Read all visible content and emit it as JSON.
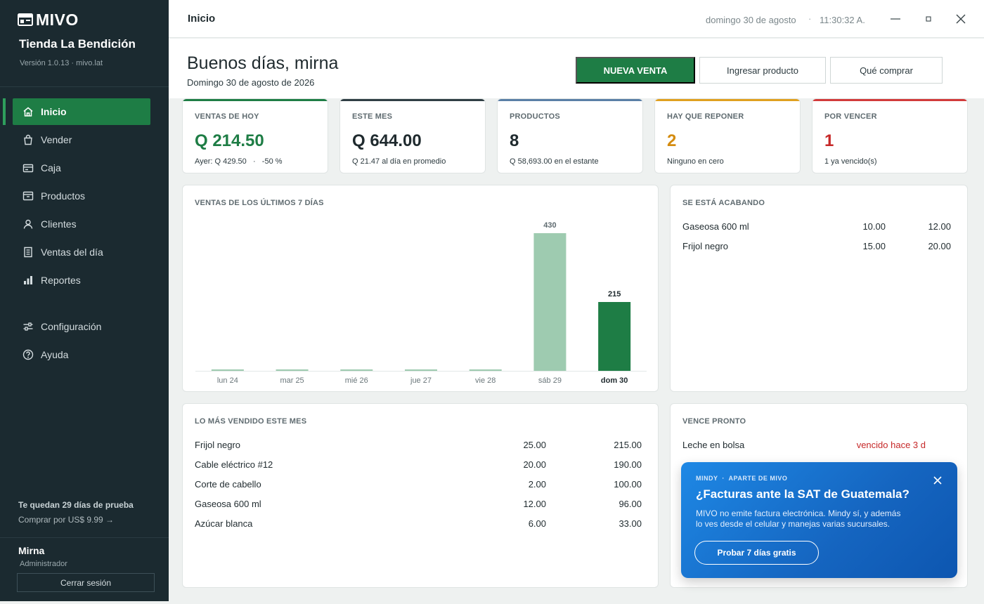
{
  "sidebar": {
    "logo_text": "MIVO",
    "store_name": "Tienda La Bendición",
    "version": "Versión 1.0.13 · mivo.lat",
    "items": [
      {
        "label": "Inicio",
        "icon": "home-icon"
      },
      {
        "label": "Vender",
        "icon": "bag-icon"
      },
      {
        "label": "Caja",
        "icon": "cash-register-icon"
      },
      {
        "label": "Productos",
        "icon": "box-icon"
      },
      {
        "label": "Clientes",
        "icon": "user-icon"
      },
      {
        "label": "Ventas del día",
        "icon": "receipt-icon"
      },
      {
        "label": "Reportes",
        "icon": "bar-chart-icon"
      },
      {
        "label": "Configuración",
        "icon": "sliders-icon"
      },
      {
        "label": "Ayuda",
        "icon": "help-icon"
      }
    ],
    "trial_title": "Te quedan 29 días de prueba",
    "trial_link": "Comprar por US$ 9.99 →",
    "user_name": "Mirna",
    "user_role": "Administrador",
    "logout_label": "Cerrar sesión"
  },
  "topbar": {
    "title": "Inicio",
    "date": "domingo 30 de agosto",
    "separator": "·",
    "time": "11:30:32 A."
  },
  "header": {
    "greeting": "Buenos días, mirna",
    "date": "Domingo 30 de agosto de 2026",
    "new_sale_label": "NUEVA VENTA",
    "add_product_label": "Ingresar producto",
    "what_to_buy_label": "Qué comprar"
  },
  "stats": [
    {
      "label": "VENTAS DE HOY",
      "value": "Q 214.50",
      "sub": "Ayer: Q 429.50   ·   -50 %",
      "accent": "#1e7d45",
      "value_color": "#1e7d45"
    },
    {
      "label": "ESTE MES",
      "value": "Q 644.00",
      "sub": "Q 21.47 al día en promedio",
      "accent": "#2f3e44",
      "value_color": "#1f2a2e"
    },
    {
      "label": "PRODUCTOS",
      "value": "8",
      "sub": "Q 58,693.00 en el estante",
      "accent": "#5a7fa6",
      "value_color": "#1f2a2e"
    },
    {
      "label": "HAY QUE REPONER",
      "value": "2",
      "sub": "Ninguno en cero",
      "accent": "#e0a020",
      "value_color": "#d48c10"
    },
    {
      "label": "POR VENCER",
      "value": "1",
      "sub": "1 ya vencido(s)",
      "accent": "#d23a3a",
      "value_color": "#c62828"
    }
  ],
  "chart_panel": {
    "title": "VENTAS DE LOS ÚLTIMOS 7 DÍAS"
  },
  "chart_data": {
    "type": "bar",
    "categories": [
      "lun 24",
      "mar 25",
      "mié 26",
      "jue 27",
      "vie 28",
      "sáb 29",
      "dom 30"
    ],
    "values": [
      0,
      0,
      0,
      0,
      0,
      430,
      215
    ],
    "value_labels": [
      "",
      "",
      "",
      "",
      "",
      "430",
      "215"
    ],
    "highlight_index": 6,
    "ylim": [
      0,
      430
    ],
    "colors": {
      "bar": "#9ecbb0",
      "highlight": "#1e7d45"
    }
  },
  "low_stock": {
    "title": "SE ESTÁ ACABANDO",
    "rows": [
      {
        "name": "Gaseosa 600 ml",
        "stock": "10.00",
        "min": "12.00"
      },
      {
        "name": "Frijol negro",
        "stock": "15.00",
        "min": "20.00"
      }
    ]
  },
  "top_sellers": {
    "title": "LO MÁS VENDIDO ESTE MES",
    "rows": [
      {
        "name": "Frijol negro",
        "qty": "25.00",
        "total": "215.00"
      },
      {
        "name": "Cable eléctrico #12",
        "qty": "20.00",
        "total": "190.00"
      },
      {
        "name": "Corte de cabello",
        "qty": "2.00",
        "total": "100.00"
      },
      {
        "name": "Gaseosa 600 ml",
        "qty": "12.00",
        "total": "96.00"
      },
      {
        "name": "Azúcar blanca",
        "qty": "6.00",
        "total": "33.00"
      }
    ]
  },
  "expiring": {
    "title": "VENCE PRONTO",
    "rows": [
      {
        "name": "Leche en bolsa",
        "status": "vencido hace 3 d",
        "status_color": "#c62828"
      }
    ]
  },
  "promo": {
    "tag": "MINDY  ·  APARTE DE MIVO",
    "title": "¿Facturas ante la SAT de Guatemala?",
    "body": "MIVO no emite factura electrónica. Mindy sí, y además lo ves desde el celular y manejas varias sucursales.",
    "button_label": "Probar 7 días gratis"
  }
}
